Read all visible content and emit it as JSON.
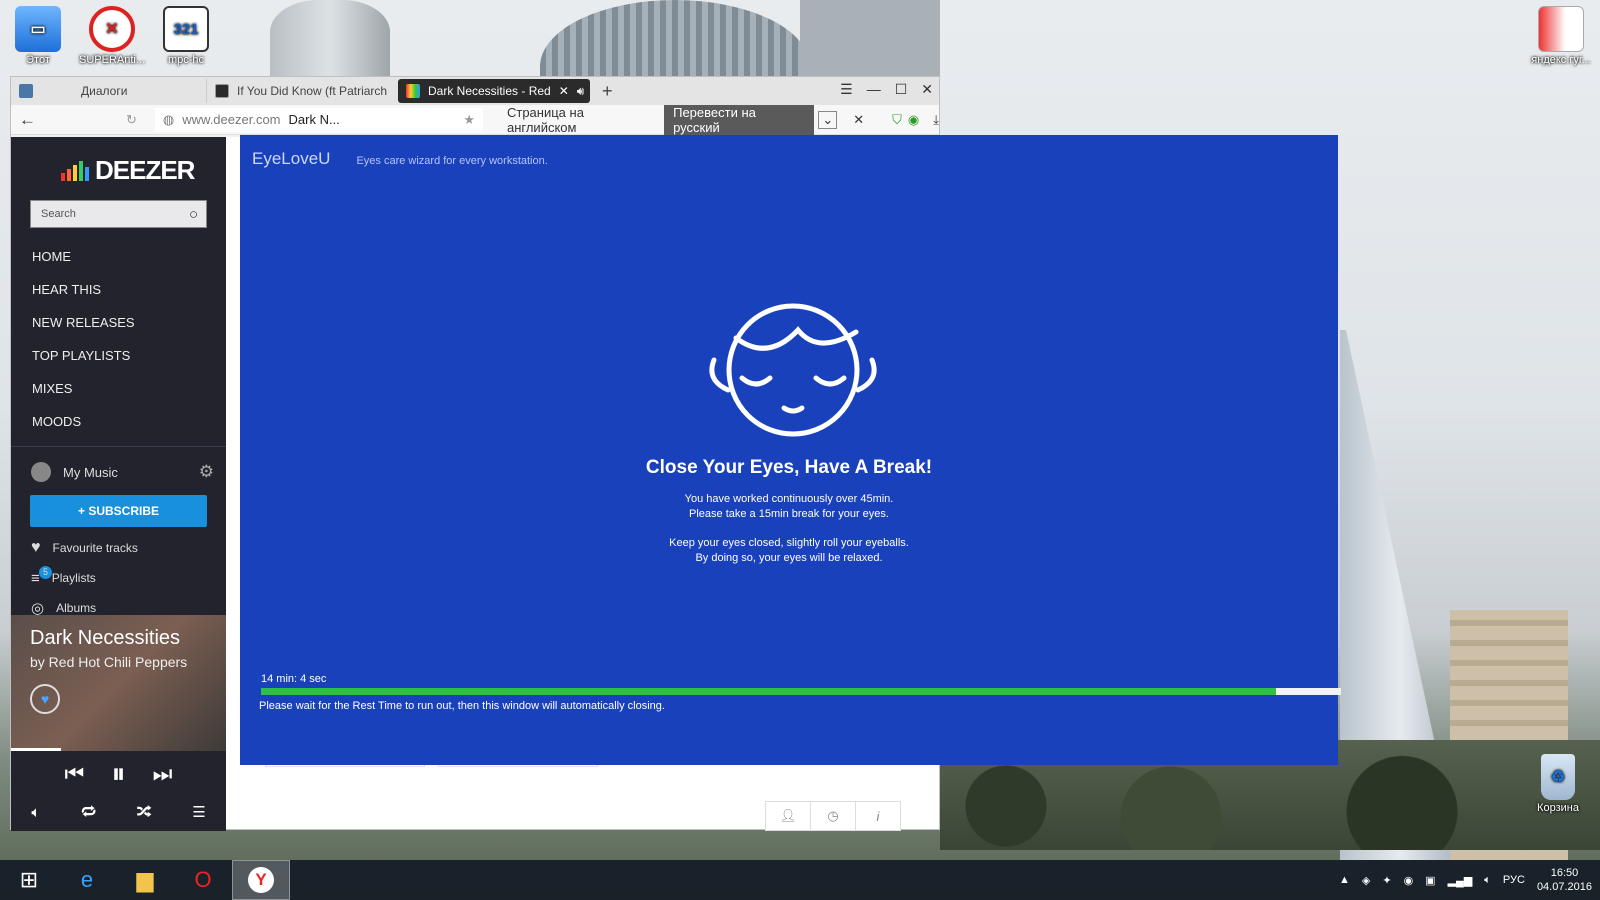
{
  "desktop": {
    "icons": [
      {
        "label": "Этот"
      },
      {
        "label": "SUPERAnti..."
      },
      {
        "label": "mpc-hc"
      },
      {
        "label": "яндекс.гуг..."
      },
      {
        "label": "Корзина"
      }
    ]
  },
  "browser": {
    "tabs": [
      {
        "label": "Диалоги"
      },
      {
        "label": "If You Did Know (ft Patriarch"
      },
      {
        "label": "Dark Necessities - Red"
      }
    ],
    "new_tab": "+",
    "url_domain": "www.deezer.com",
    "url_title": "Dark N...",
    "page_language": "Страница на английском",
    "translate_button": "Перевести на русский"
  },
  "deezer": {
    "logo": "DEEZER",
    "search_placeholder": "Search",
    "nav": [
      "HOME",
      "HEAR THIS",
      "NEW RELEASES",
      "TOP PLAYLISTS",
      "MIXES",
      "MOODS"
    ],
    "my_music": "My Music",
    "subscribe": "+ SUBSCRIBE",
    "library": {
      "favourite": "Favourite tracks",
      "playlists": "Playlists",
      "playlists_count": "5",
      "albums": "Albums"
    },
    "now_playing": {
      "title": "Dark Necessities",
      "artist": "by Red Hot Chili Peppers"
    }
  },
  "eyeloveu": {
    "brand": "EyeLoveU",
    "tagline": "Eyes care wizard for every workstation.",
    "title": "Close Your Eyes, Have A Break!",
    "msg1_line1": "You have worked continuously over 45min.",
    "msg1_line2": "Please take a 15min break for your eyes.",
    "msg2_line1": "Keep your eyes closed, slightly roll your eyeballs.",
    "msg2_line2": "By doing so, your eyes will be relaxed.",
    "timer": "14 min: 4 sec",
    "progress_fraction": 0.94,
    "wait_text": "Please wait for the Rest Time to run out, then this window will automatically closing.",
    "bg_color": "#1a41bc",
    "progress_color": "#2fbf4a"
  },
  "taskbar": {
    "lang": "РУС",
    "time": "16:50",
    "date": "04.07.2016"
  }
}
